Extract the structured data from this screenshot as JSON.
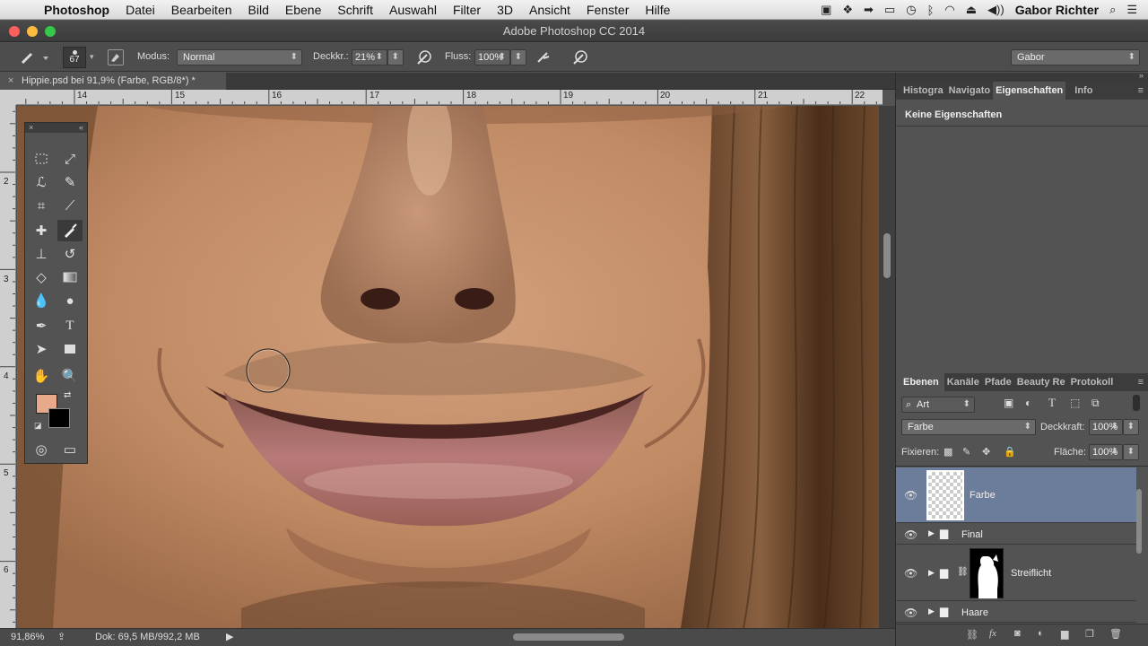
{
  "menubar": {
    "app": "Photoshop",
    "items": [
      "Datei",
      "Bearbeiten",
      "Bild",
      "Ebene",
      "Schrift",
      "Auswahl",
      "Filter",
      "3D",
      "Ansicht",
      "Fenster",
      "Hilfe"
    ],
    "user": "Gabor Richter"
  },
  "window": {
    "title": "Adobe Photoshop CC 2014"
  },
  "options": {
    "brush_size": "67",
    "mode_label": "Modus:",
    "mode_value": "Normal",
    "opacity_label": "Deckkr.:",
    "opacity_value": "21%",
    "flow_label": "Fluss:",
    "flow_value": "100%",
    "workspace": "Gabor"
  },
  "document": {
    "tab": "Hippie.psd bei 91,9% (Farbe, RGB/8*) *"
  },
  "rulers": {
    "top": [
      "14",
      "15",
      "16",
      "17",
      "18",
      "19",
      "20",
      "21",
      "22"
    ],
    "left": [
      "2",
      "3",
      "4",
      "5",
      "6"
    ]
  },
  "status": {
    "zoom": "91,86%",
    "doc": "Dok: 69,5 MB/992,2 MB"
  },
  "properties": {
    "tabs": [
      "Histogra",
      "Navigato",
      "Eigenschaften",
      "Info"
    ],
    "content": "Keine Eigenschaften"
  },
  "layers": {
    "tabs": [
      "Ebenen",
      "Kanäle",
      "Pfade",
      "Beauty Re",
      "Protokoll"
    ],
    "filter": "Art",
    "blend_mode": "Farbe",
    "opacity_label": "Deckkraft:",
    "opacity_value": "100%",
    "lock_label": "Fixieren:",
    "fill_label": "Fläche:",
    "fill_value": "100%",
    "items": [
      {
        "name": "Farbe"
      },
      {
        "name": "Final"
      },
      {
        "name": "Streiflicht"
      },
      {
        "name": "Haare"
      }
    ]
  },
  "colors": {
    "foreground": "#e8a98a",
    "background": "#000000",
    "selected_layer": "#6b7d9b"
  }
}
